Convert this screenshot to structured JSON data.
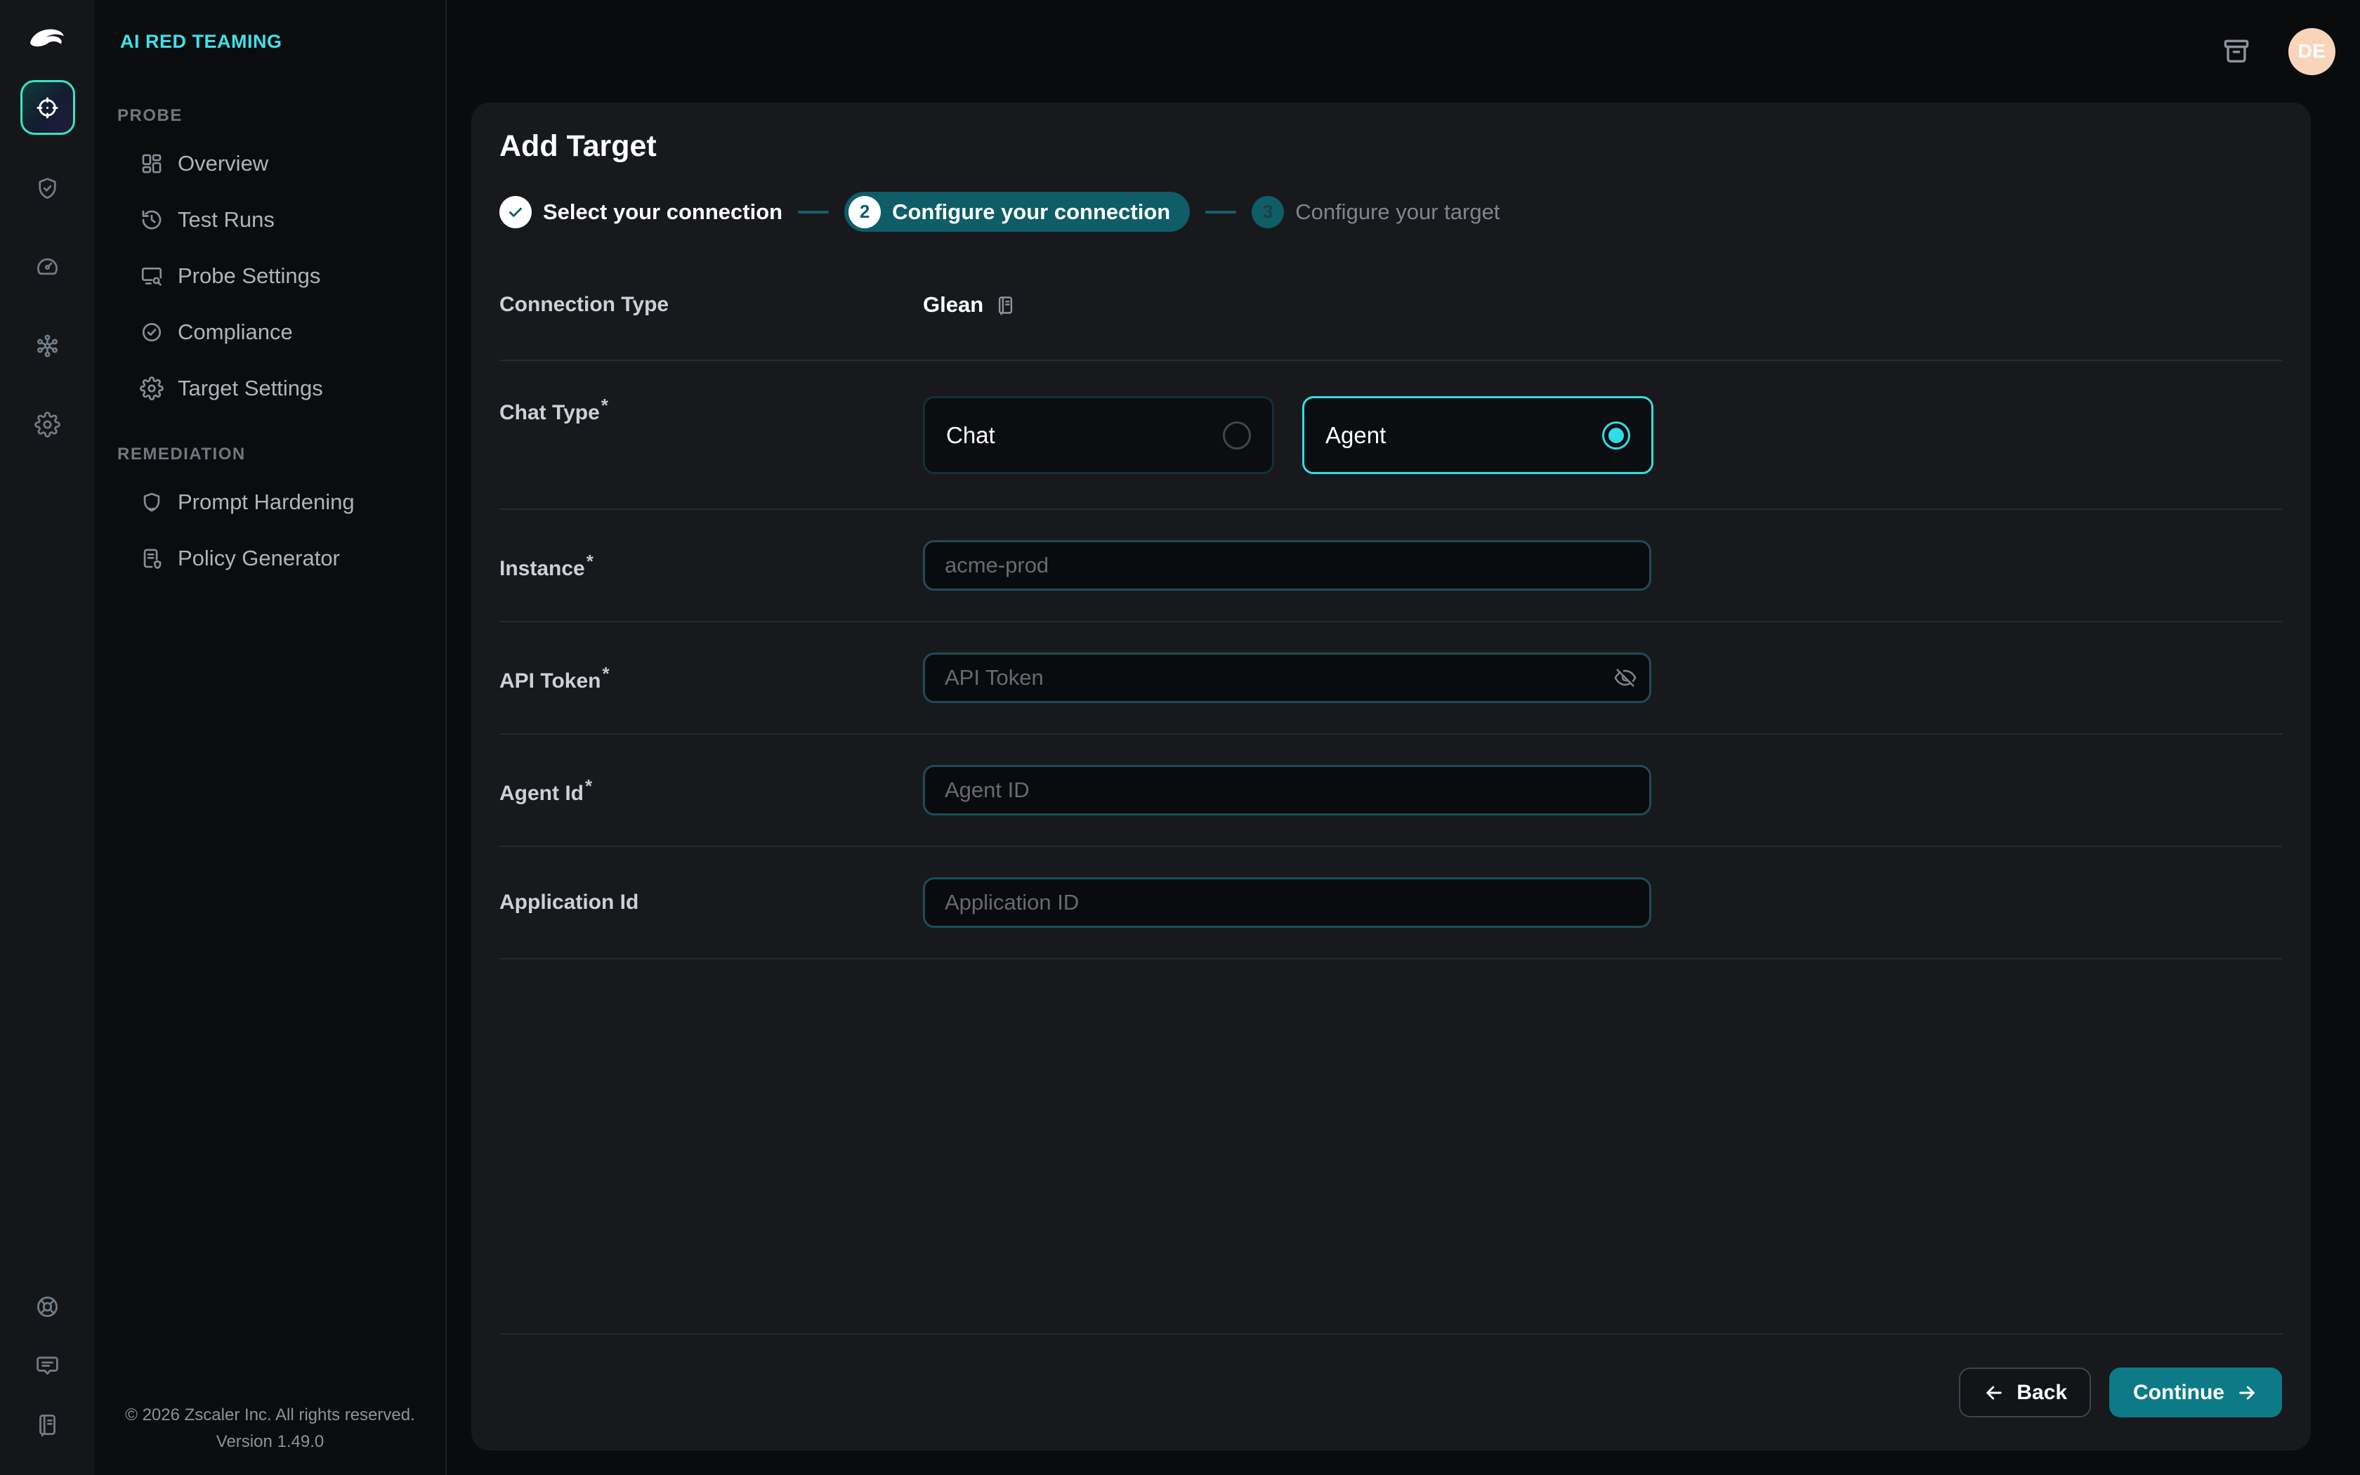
{
  "brand": {
    "product": "AI RED TEAMING"
  },
  "topbar": {
    "avatar_initials": "DE"
  },
  "sidebar": {
    "sections": [
      {
        "title": "PROBE",
        "items": [
          {
            "label": "Overview"
          },
          {
            "label": "Test Runs"
          },
          {
            "label": "Probe Settings"
          },
          {
            "label": "Compliance"
          },
          {
            "label": "Target Settings"
          }
        ]
      },
      {
        "title": "REMEDIATION",
        "items": [
          {
            "label": "Prompt Hardening"
          },
          {
            "label": "Policy Generator"
          }
        ]
      }
    ],
    "footer": {
      "copyright": "© 2026 Zscaler Inc. All rights reserved.",
      "version": "Version 1.49.0"
    }
  },
  "page": {
    "title": "Add Target",
    "stepper": [
      {
        "number": "1",
        "label": "Select your connection",
        "state": "complete"
      },
      {
        "number": "2",
        "label": "Configure your connection",
        "state": "active"
      },
      {
        "number": "3",
        "label": "Configure your target",
        "state": "upcoming"
      }
    ],
    "form": {
      "connection_type": {
        "label": "Connection Type",
        "value": "Glean"
      },
      "chat_type": {
        "label": "Chat Type",
        "required": true,
        "options": [
          {
            "label": "Chat",
            "selected": false
          },
          {
            "label": "Agent",
            "selected": true
          }
        ]
      },
      "instance": {
        "label": "Instance",
        "required": true,
        "placeholder": "acme-prod",
        "value": ""
      },
      "api_token": {
        "label": "API Token",
        "required": true,
        "placeholder": "API Token",
        "value": ""
      },
      "agent_id": {
        "label": "Agent Id",
        "required": true,
        "placeholder": "Agent ID",
        "value": ""
      },
      "application_id": {
        "label": "Application Id",
        "required": false,
        "placeholder": "Application ID",
        "value": ""
      }
    },
    "footer": {
      "back_label": "Back",
      "continue_label": "Continue"
    }
  },
  "ui": {
    "required_marker": "*",
    "icons": {
      "zscaler-logo": "swoosh",
      "target-icon": "crosshair",
      "shield-check-icon": "shield+check",
      "gauge-icon": "speedometer",
      "hub-icon": "network nodes",
      "gear-icon": "cog",
      "grid-icon": "dashboard tiles",
      "history-icon": "clock arrow",
      "monitor-search-icon": "screen+magnifier",
      "badge-check-icon": "circle+check",
      "prompt-shield-icon": "shield",
      "policy-doc-icon": "document+shield",
      "lifebuoy-icon": "help ring",
      "chat-bubble-icon": "message square",
      "notebook-icon": "bound notebook",
      "archive-icon": "storage box",
      "eye-off-icon": "hidden password",
      "check-icon": "checkmark",
      "arrow-left-icon": "back arrow",
      "arrow-right-icon": "forward arrow"
    },
    "colors": {
      "brand_cyan": "#3fe1e9",
      "step_teal": "#0e5d67",
      "continue_teal": "#0d7b87",
      "active_rail_border": "#38e5c1",
      "selected_radio": "#2fdbe6",
      "avatar_bg": "#f8d5ba",
      "panel_bg": "#17191d"
    }
  }
}
